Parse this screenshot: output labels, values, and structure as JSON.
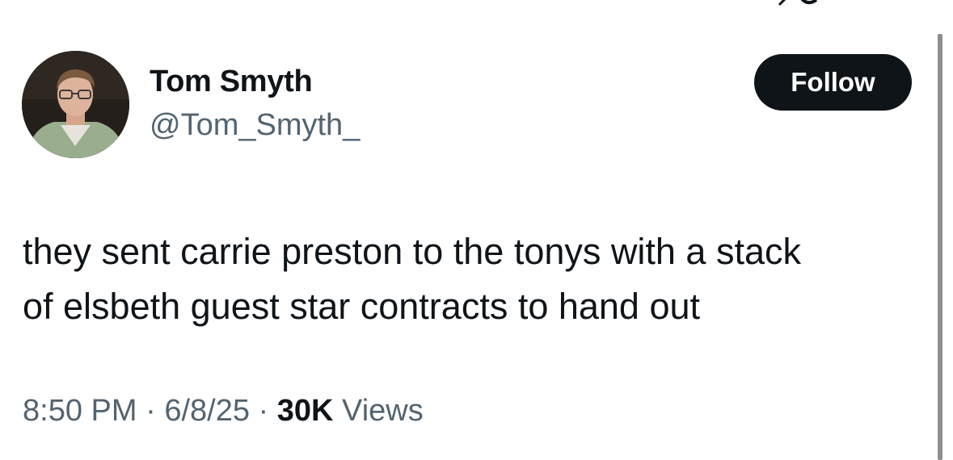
{
  "user": {
    "display_name": "Tom Smyth",
    "handle": "@Tom_Smyth_",
    "avatar_icon": "profile-photo"
  },
  "actions": {
    "follow_label": "Follow"
  },
  "tweet": {
    "text_lines": [
      "they sent carrie preston to the tonys with a stack",
      "of elsbeth guest star contracts to hand out"
    ],
    "time": "8:50 PM",
    "separator": "·",
    "date": "6/8/25",
    "views_count": "30K",
    "views_label": "Views"
  },
  "colors": {
    "text_primary": "#0f1419",
    "text_secondary": "#536471",
    "button_bg": "#0f1419",
    "button_text": "#ffffff",
    "scrollbar": "#8e8e8e"
  }
}
